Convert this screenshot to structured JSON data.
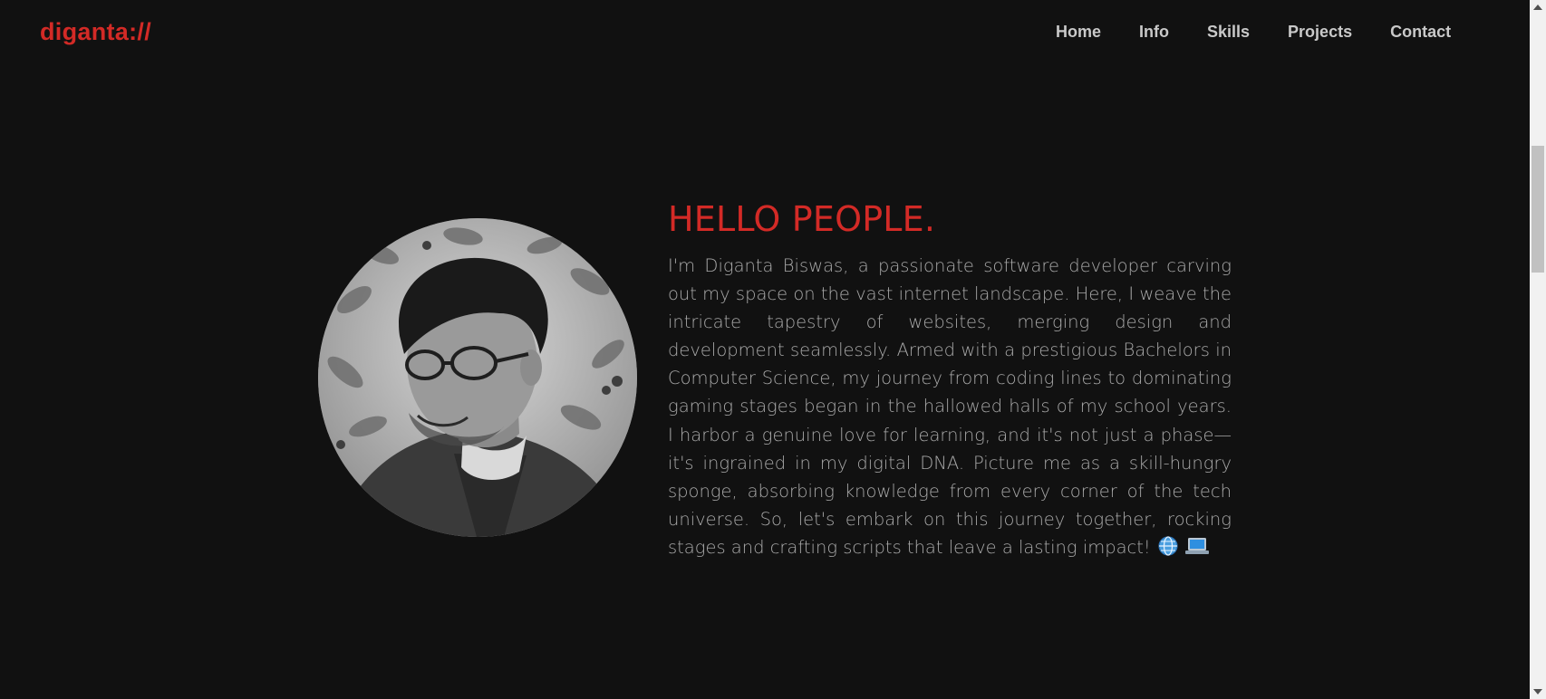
{
  "header": {
    "logo": "diganta://",
    "nav": [
      "Home",
      "Info",
      "Skills",
      "Projects",
      "Contact"
    ]
  },
  "hero": {
    "title": "HELLO PEOPLE.",
    "body": "I'm Diganta Biswas, a passionate software developer carving out my space on the vast internet landscape. Here, I weave the intricate tapestry of websites, merging design and development seamlessly. Armed with a prestigious Bachelors in Computer Science, my journey from coding lines to dominating gaming stages began in the hallowed halls of my school years. I harbor a genuine love for learning, and it's not just a phase—it's ingrained in my digital DNA. Picture me as a skill-hungry sponge, absorbing knowledge from every corner of the tech universe. So, let's embark on this journey together, rocking stages and crafting scripts that leave a lasting impact!",
    "emojis": [
      "globe-icon",
      "laptop-icon"
    ],
    "avatar": "profile-photo"
  },
  "colors": {
    "background": "#111111",
    "accent": "#d32a26",
    "nav_text": "#c9c9c9",
    "body_text": "#a9a9a9"
  }
}
